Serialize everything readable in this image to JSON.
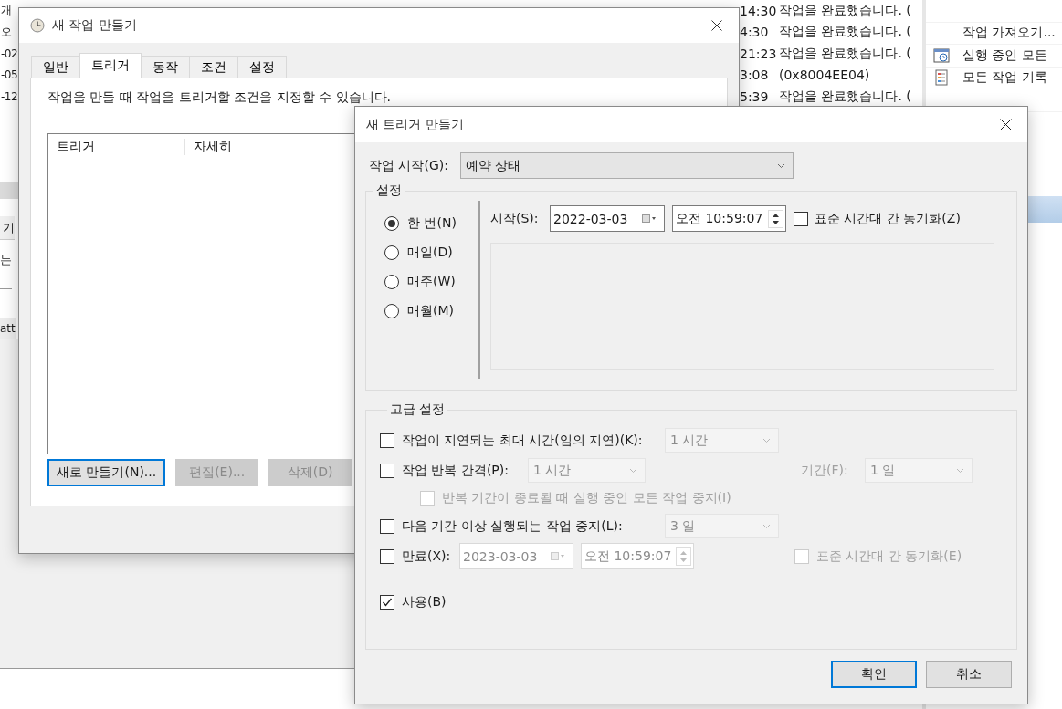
{
  "background_app": {
    "history_rows": [
      {
        "name": "개",
        "time": "14:30",
        "result": "작업을 완료했습니다. ("
      },
      {
        "name": "오",
        "time": "4:30",
        "result": "작업을 완료했습니다. ("
      },
      {
        "name": "-02",
        "time": "21:23",
        "result": "작업을 완료했습니다. ("
      },
      {
        "name": "-05",
        "time": "3:08",
        "result": "(0x8004EE04)"
      },
      {
        "name": "-12",
        "time": "5:39",
        "result": "작업을 완료했습니다. ("
      }
    ],
    "left_tab": "기",
    "left_text": "는",
    "left_row": "att",
    "actions": [
      {
        "label": "작업 가져오기...",
        "kind": "plain"
      },
      {
        "label": "실행 중인 모든",
        "kind": "running"
      },
      {
        "label": "모든 작업 기록",
        "kind": "history"
      }
    ]
  },
  "task_dialog": {
    "title": "새 작업 만들기",
    "tabs": [
      {
        "label": "일반",
        "selected": false
      },
      {
        "label": "트리거",
        "selected": true
      },
      {
        "label": "동작",
        "selected": false
      },
      {
        "label": "조건",
        "selected": false
      },
      {
        "label": "설정",
        "selected": false
      }
    ],
    "description": "작업을 만들 때 작업을 트리거할 조건을 지정할 수 있습니다.",
    "trigger_list": {
      "columns": [
        "트리거",
        "자세히"
      ]
    },
    "buttons": [
      {
        "label": "새로 만들기(N)...",
        "disabled": false,
        "focused": true
      },
      {
        "label": "편집(E)...",
        "disabled": true,
        "focused": false
      },
      {
        "label": "삭제(D)",
        "disabled": true,
        "focused": false
      }
    ]
  },
  "trigger_dialog": {
    "title": "새 트리거 만들기",
    "begin_task": {
      "label": "작업 시작(G):",
      "value": "예약 상태"
    },
    "settings": {
      "title": "설정",
      "schedules": [
        {
          "label": "한 번(N)",
          "selected": true
        },
        {
          "label": "매일(D)",
          "selected": false
        },
        {
          "label": "매주(W)",
          "selected": false
        },
        {
          "label": "매월(M)",
          "selected": false
        }
      ],
      "start_label": "시작(S):",
      "start_date": "2022-03-03",
      "start_time": "오전 10:59:07",
      "sync": {
        "label": "표준 시간대 간 동기화(Z)",
        "checked": false
      }
    },
    "advanced": {
      "title": "고급 설정",
      "delay": {
        "label": "작업이 지연되는 최대 시간(임의 지연)(K):",
        "checked": false,
        "value": "1 시간"
      },
      "repeat": {
        "label": "작업 반복 간격(P):",
        "checked": false,
        "value": "1 시간",
        "duration_label": "기간(F):",
        "duration": "1 일"
      },
      "stop_at_end": {
        "label": "반복 기간이 종료될 때 실행 중인 모든 작업 중지(I)",
        "checked": false,
        "disabled": true
      },
      "stop_longer": {
        "label": "다음 기간 이상 실행되는 작업 중지(L):",
        "checked": false,
        "value": "3 일"
      },
      "expire": {
        "label": "만료(X):",
        "checked": false,
        "date": "2023-03-03",
        "time": "오전 10:59:07",
        "sync": {
          "label": "표준 시간대 간 동기화(E)",
          "checked": false,
          "disabled": true
        }
      },
      "enabled": {
        "label": "사용(B)",
        "checked": true
      }
    },
    "buttons": [
      {
        "label": "확인",
        "focused": true
      },
      {
        "label": "취소",
        "focused": false
      }
    ]
  }
}
